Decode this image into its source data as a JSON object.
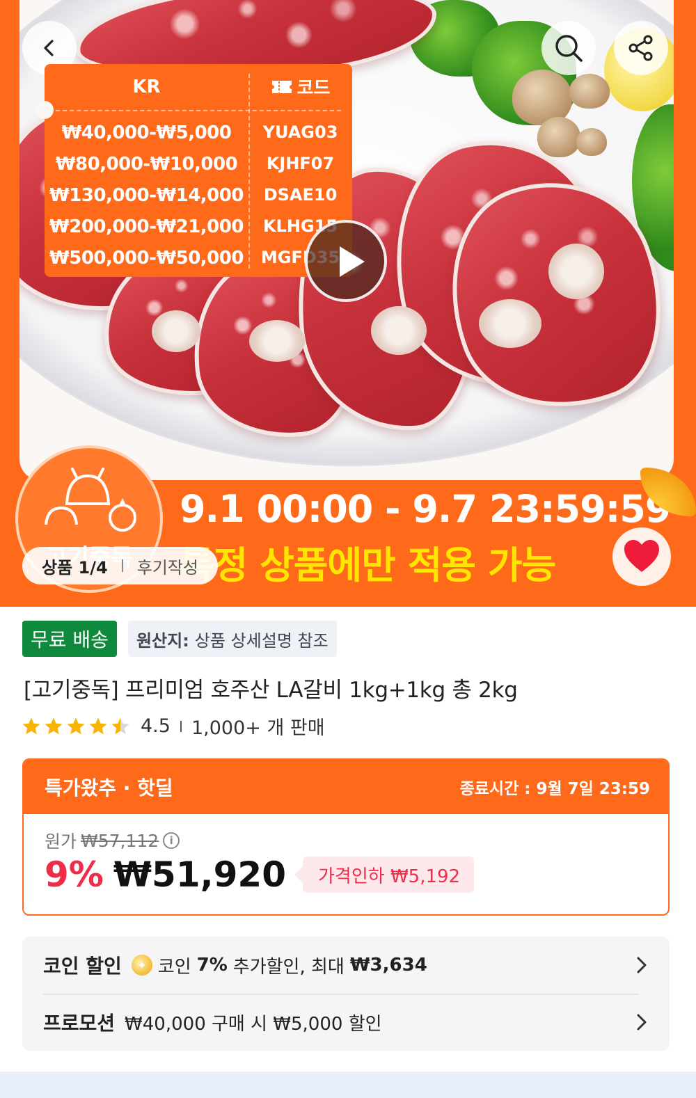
{
  "hero": {
    "coupon": {
      "header_left": "KR",
      "header_right": "코드",
      "rows": [
        {
          "amount": "₩40,000-₩5,000",
          "code": "YUAG03"
        },
        {
          "amount": "₩80,000-₩10,000",
          "code": "KJHF07"
        },
        {
          "amount": "₩130,000-₩14,000",
          "code": "DSAE10"
        },
        {
          "amount": "₩200,000-₩21,000",
          "code": "KLHG15"
        },
        {
          "amount": "₩500,000-₩50,000",
          "code": "MGFD35"
        }
      ]
    },
    "logo_text": "고기중독",
    "event_date": "9.1 00:00 - 9.7 23:59:59",
    "event_note": "특정 상품에만 적용 가능",
    "image_counter": "상품 1/4",
    "review_link": "후기작성"
  },
  "product": {
    "shipping_badge": "무료 배송",
    "origin_label": "원산지:",
    "origin_value": "상품 상세설명 참조",
    "title": "[고기중독] 프리미엄 호주산 LA갈비 1kg+1kg 총 2kg",
    "rating": "4.5",
    "rating_value": 4.5,
    "sold": "1,000+ 개 판매"
  },
  "deal": {
    "title": "특가왔추 · 핫딜",
    "end_time": "종료시간 : 9월 7일 23:59",
    "original_label": "원가",
    "original_price": "₩57,112",
    "discount": "9%",
    "price": "₩51,920",
    "price_cut": "가격인하 ₩5,192"
  },
  "promos": {
    "coin_label": "코인 할인",
    "coin_prefix": "코인",
    "coin_percent": "7%",
    "coin_text": "추가할인, 최대",
    "coin_max": "₩3,634",
    "promo_label": "프로모션",
    "promo_text": "₩40,000 구매 시 ₩5,000 할인"
  },
  "colors": {
    "brand_orange": "#ff6a1a",
    "discount_red": "#ef2d4b",
    "ship_green": "#0f8a3c",
    "star": "#f7b500"
  },
  "icons": [
    "back-icon",
    "search-icon",
    "share-icon",
    "play-icon",
    "heart-icon",
    "ticket-icon",
    "info-icon",
    "coin-icon",
    "chevron-right-icon",
    "star-icon"
  ]
}
